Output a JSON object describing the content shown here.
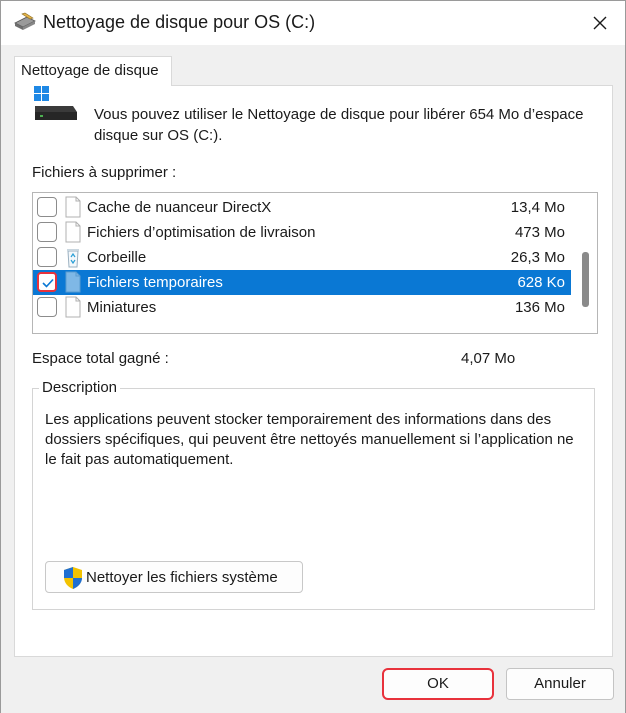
{
  "window": {
    "title": "Nettoyage de disque pour OS (C:)",
    "close_icon": "close-icon"
  },
  "tab": {
    "label": "Nettoyage de disque"
  },
  "intro": {
    "text": "Vous pouvez utiliser le Nettoyage de disque pour libérer 654 Mo d’espace disque sur OS (C:)."
  },
  "files": {
    "label": "Fichiers à supprimer :",
    "items": [
      {
        "name": "Cache de nuanceur DirectX",
        "size": "13,4 Mo",
        "checked": false,
        "selected": false,
        "icon": "file-icon"
      },
      {
        "name": "Fichiers d’optimisation de livraison",
        "size": "473 Mo",
        "checked": false,
        "selected": false,
        "icon": "file-icon"
      },
      {
        "name": "Corbeille",
        "size": "26,3 Mo",
        "checked": false,
        "selected": false,
        "icon": "recycle-bin-icon"
      },
      {
        "name": "Fichiers temporaires",
        "size": "628 Ko",
        "checked": true,
        "selected": true,
        "icon": "file-icon"
      },
      {
        "name": "Miniatures",
        "size": "136 Mo",
        "checked": false,
        "selected": false,
        "icon": "file-icon"
      }
    ]
  },
  "total": {
    "label": "Espace total gagné :",
    "value": "4,07 Mo"
  },
  "description": {
    "legend": "Description",
    "text": "Les applications peuvent stocker temporairement des informations dans des dossiers spécifiques, qui peuvent être nettoyés manuellement si l’application ne le fait pas automatiquement."
  },
  "system_button": {
    "label": "Nettoyer les fichiers système",
    "icon": "uac-shield-icon"
  },
  "footer": {
    "ok_label": "OK",
    "cancel_label": "Annuler"
  },
  "colors": {
    "selection": "#0a78d4",
    "highlight_border": "#e8323c",
    "background": "#f0f0f0"
  }
}
